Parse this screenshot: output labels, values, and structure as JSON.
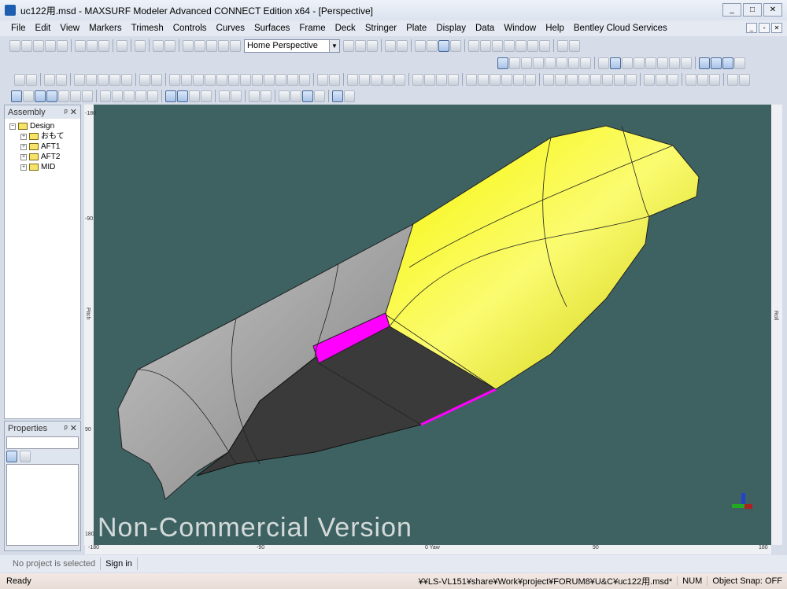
{
  "window": {
    "title": "uc122用.msd - MAXSURF Modeler Advanced CONNECT Edition x64 - [Perspective]",
    "controls": [
      "minimize",
      "maximize",
      "close"
    ]
  },
  "menu": [
    "File",
    "Edit",
    "View",
    "Markers",
    "Trimesh",
    "Controls",
    "Curves",
    "Surfaces",
    "Frame",
    "Deck",
    "Stringer",
    "Plate",
    "Display",
    "Data",
    "Window",
    "Help",
    "Bentley Cloud Services"
  ],
  "toolbar": {
    "view_combo": "Home Perspective"
  },
  "assembly": {
    "title": "Assembly",
    "root": "Design",
    "children": [
      "おもて",
      "AFT1",
      "AFT2",
      "MID"
    ]
  },
  "properties": {
    "title": "Properties"
  },
  "viewport": {
    "watermark": "Non-Commercial Version",
    "bottom_ruler": [
      "-180",
      "-90",
      "0 Yaw",
      "90",
      "180"
    ],
    "left_ruler": [
      "-180",
      "-90",
      "Pitch",
      "90",
      "180"
    ],
    "right_ruler": [
      "Roll"
    ],
    "colors": {
      "background": "#3e6262",
      "hull_gray": "#a6a6a6",
      "hull_dark": "#3a3a3a",
      "hull_yellow": "#f2f200",
      "strip": "#ff00ff"
    }
  },
  "tabs": {
    "project": "No project is selected",
    "signin": "Sign in"
  },
  "status": {
    "state": "Ready",
    "path": "¥¥LS-VL151¥share¥Work¥project¥FORUM8¥U&C¥uc122用.msd*",
    "num": "NUM",
    "snap": "Object Snap: OFF"
  }
}
